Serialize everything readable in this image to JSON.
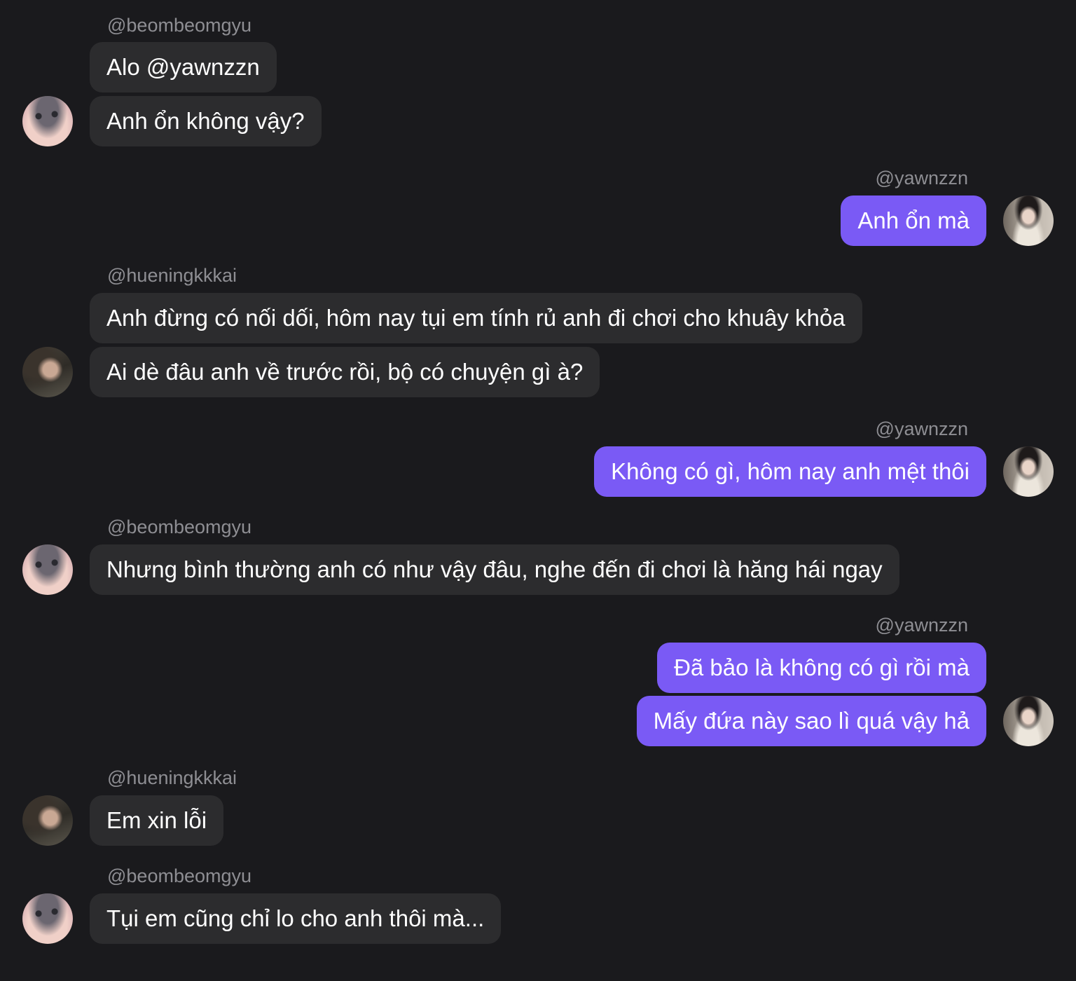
{
  "theme": {
    "background": "#1a1a1d",
    "incoming_bubble": "#2c2c2e",
    "outgoing_bubble": "#7a5af5",
    "username_color": "#8e8e93",
    "text_color": "#ffffff"
  },
  "groups": [
    {
      "username": "@beombeomgyu",
      "avatar": "beombeomgyu-avatar",
      "messages": [
        "Alo @yawnzzn",
        "Anh ổn không vậy?"
      ]
    },
    {
      "username": "@yawnzzn",
      "avatar": "yawnzzn-avatar",
      "messages": [
        "Anh ổn mà"
      ]
    },
    {
      "username": "@hueningkkkai",
      "avatar": "hueningkkkai-avatar",
      "messages": [
        "Anh đừng có nối dối, hôm nay tụi em tính rủ anh đi chơi cho khuây khỏa",
        "Ai dè đâu anh về trước rồi, bộ có chuyện gì à?"
      ]
    },
    {
      "username": "@yawnzzn",
      "avatar": "yawnzzn-avatar",
      "messages": [
        "Không có gì, hôm nay anh mệt thôi"
      ]
    },
    {
      "username": "@beombeomgyu",
      "avatar": "beombeomgyu-avatar",
      "messages": [
        "Nhưng bình thường anh có như vậy đâu, nghe đến đi chơi là hăng hái ngay"
      ]
    },
    {
      "username": "@yawnzzn",
      "avatar": "yawnzzn-avatar",
      "messages": [
        "Đã bảo là không có gì rồi mà",
        "Mấy đứa này sao lì quá vậy hả"
      ]
    },
    {
      "username": "@hueningkkkai",
      "avatar": "hueningkkkai-avatar",
      "messages": [
        "Em xin lỗi"
      ]
    },
    {
      "username": "@beombeomgyu",
      "avatar": "beombeomgyu-avatar",
      "messages": [
        "Tụi em cũng chỉ lo cho anh thôi mà..."
      ]
    }
  ]
}
